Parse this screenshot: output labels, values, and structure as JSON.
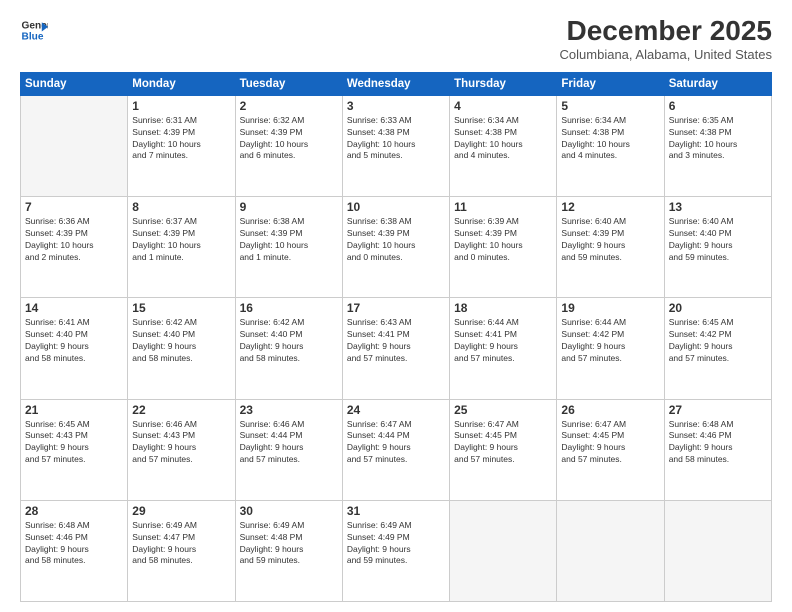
{
  "logo": {
    "line1": "General",
    "line2": "Blue"
  },
  "title": "December 2025",
  "location": "Columbiana, Alabama, United States",
  "days_header": [
    "Sunday",
    "Monday",
    "Tuesday",
    "Wednesday",
    "Thursday",
    "Friday",
    "Saturday"
  ],
  "weeks": [
    [
      {
        "num": "",
        "info": ""
      },
      {
        "num": "1",
        "info": "Sunrise: 6:31 AM\nSunset: 4:39 PM\nDaylight: 10 hours\nand 7 minutes."
      },
      {
        "num": "2",
        "info": "Sunrise: 6:32 AM\nSunset: 4:39 PM\nDaylight: 10 hours\nand 6 minutes."
      },
      {
        "num": "3",
        "info": "Sunrise: 6:33 AM\nSunset: 4:38 PM\nDaylight: 10 hours\nand 5 minutes."
      },
      {
        "num": "4",
        "info": "Sunrise: 6:34 AM\nSunset: 4:38 PM\nDaylight: 10 hours\nand 4 minutes."
      },
      {
        "num": "5",
        "info": "Sunrise: 6:34 AM\nSunset: 4:38 PM\nDaylight: 10 hours\nand 4 minutes."
      },
      {
        "num": "6",
        "info": "Sunrise: 6:35 AM\nSunset: 4:38 PM\nDaylight: 10 hours\nand 3 minutes."
      }
    ],
    [
      {
        "num": "7",
        "info": "Sunrise: 6:36 AM\nSunset: 4:39 PM\nDaylight: 10 hours\nand 2 minutes."
      },
      {
        "num": "8",
        "info": "Sunrise: 6:37 AM\nSunset: 4:39 PM\nDaylight: 10 hours\nand 1 minute."
      },
      {
        "num": "9",
        "info": "Sunrise: 6:38 AM\nSunset: 4:39 PM\nDaylight: 10 hours\nand 1 minute."
      },
      {
        "num": "10",
        "info": "Sunrise: 6:38 AM\nSunset: 4:39 PM\nDaylight: 10 hours\nand 0 minutes."
      },
      {
        "num": "11",
        "info": "Sunrise: 6:39 AM\nSunset: 4:39 PM\nDaylight: 10 hours\nand 0 minutes."
      },
      {
        "num": "12",
        "info": "Sunrise: 6:40 AM\nSunset: 4:39 PM\nDaylight: 9 hours\nand 59 minutes."
      },
      {
        "num": "13",
        "info": "Sunrise: 6:40 AM\nSunset: 4:40 PM\nDaylight: 9 hours\nand 59 minutes."
      }
    ],
    [
      {
        "num": "14",
        "info": "Sunrise: 6:41 AM\nSunset: 4:40 PM\nDaylight: 9 hours\nand 58 minutes."
      },
      {
        "num": "15",
        "info": "Sunrise: 6:42 AM\nSunset: 4:40 PM\nDaylight: 9 hours\nand 58 minutes."
      },
      {
        "num": "16",
        "info": "Sunrise: 6:42 AM\nSunset: 4:40 PM\nDaylight: 9 hours\nand 58 minutes."
      },
      {
        "num": "17",
        "info": "Sunrise: 6:43 AM\nSunset: 4:41 PM\nDaylight: 9 hours\nand 57 minutes."
      },
      {
        "num": "18",
        "info": "Sunrise: 6:44 AM\nSunset: 4:41 PM\nDaylight: 9 hours\nand 57 minutes."
      },
      {
        "num": "19",
        "info": "Sunrise: 6:44 AM\nSunset: 4:42 PM\nDaylight: 9 hours\nand 57 minutes."
      },
      {
        "num": "20",
        "info": "Sunrise: 6:45 AM\nSunset: 4:42 PM\nDaylight: 9 hours\nand 57 minutes."
      }
    ],
    [
      {
        "num": "21",
        "info": "Sunrise: 6:45 AM\nSunset: 4:43 PM\nDaylight: 9 hours\nand 57 minutes."
      },
      {
        "num": "22",
        "info": "Sunrise: 6:46 AM\nSunset: 4:43 PM\nDaylight: 9 hours\nand 57 minutes."
      },
      {
        "num": "23",
        "info": "Sunrise: 6:46 AM\nSunset: 4:44 PM\nDaylight: 9 hours\nand 57 minutes."
      },
      {
        "num": "24",
        "info": "Sunrise: 6:47 AM\nSunset: 4:44 PM\nDaylight: 9 hours\nand 57 minutes."
      },
      {
        "num": "25",
        "info": "Sunrise: 6:47 AM\nSunset: 4:45 PM\nDaylight: 9 hours\nand 57 minutes."
      },
      {
        "num": "26",
        "info": "Sunrise: 6:47 AM\nSunset: 4:45 PM\nDaylight: 9 hours\nand 57 minutes."
      },
      {
        "num": "27",
        "info": "Sunrise: 6:48 AM\nSunset: 4:46 PM\nDaylight: 9 hours\nand 58 minutes."
      }
    ],
    [
      {
        "num": "28",
        "info": "Sunrise: 6:48 AM\nSunset: 4:46 PM\nDaylight: 9 hours\nand 58 minutes."
      },
      {
        "num": "29",
        "info": "Sunrise: 6:49 AM\nSunset: 4:47 PM\nDaylight: 9 hours\nand 58 minutes."
      },
      {
        "num": "30",
        "info": "Sunrise: 6:49 AM\nSunset: 4:48 PM\nDaylight: 9 hours\nand 59 minutes."
      },
      {
        "num": "31",
        "info": "Sunrise: 6:49 AM\nSunset: 4:49 PM\nDaylight: 9 hours\nand 59 minutes."
      },
      {
        "num": "",
        "info": ""
      },
      {
        "num": "",
        "info": ""
      },
      {
        "num": "",
        "info": ""
      }
    ]
  ]
}
